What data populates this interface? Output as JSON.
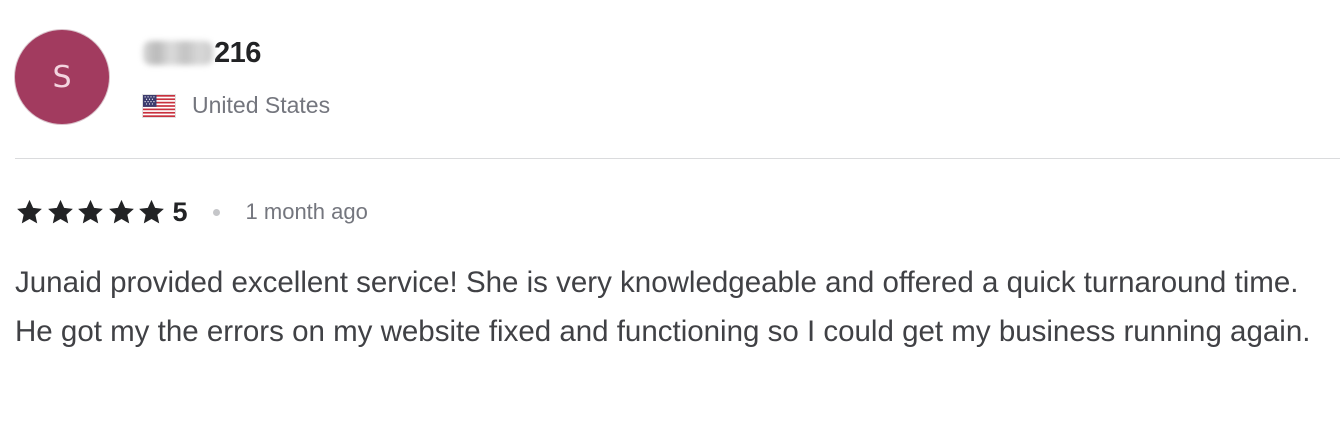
{
  "reviewer": {
    "avatar_letter": "S",
    "avatar_color": "#a23b5f",
    "username_visible": "216",
    "username_prefix_blurred": true,
    "country": "United States",
    "flag_icon": "us-flag-icon"
  },
  "rating": {
    "stars": 5,
    "score": "5",
    "time_ago": "1 month ago"
  },
  "review": {
    "text": "Junaid provided excellent service! She is very knowledgeable and offered a quick turnaround time. He got my the errors on my website fixed and functioning so I could get my business running again."
  }
}
